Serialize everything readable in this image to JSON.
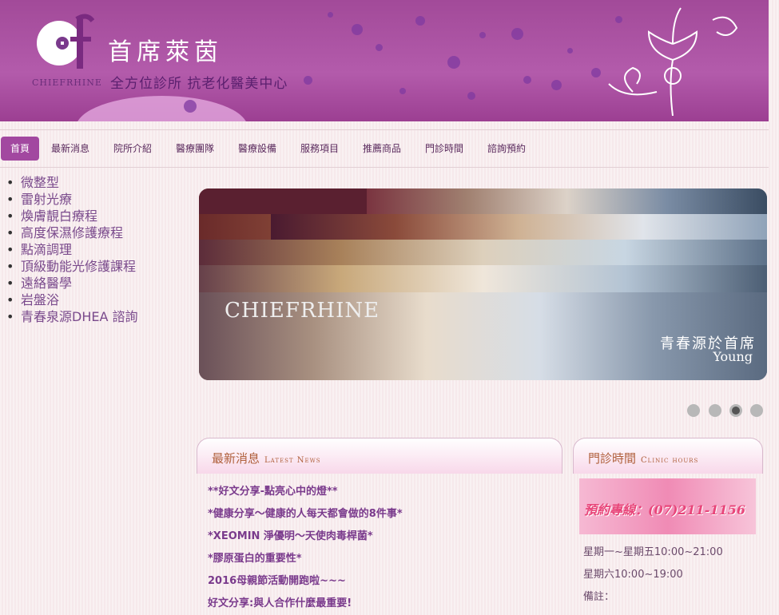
{
  "header": {
    "brand_name": "首席萊茵",
    "brand_en": "CHIEFRHINE",
    "tagline": "全方位診所 抗老化醫美中心"
  },
  "nav": {
    "items": [
      "首頁",
      "最新消息",
      "院所介紹",
      "醫療團隊",
      "醫療設備",
      "服務項目",
      "推薦商品",
      "門診時間",
      "諮詢預約"
    ],
    "active": "首頁"
  },
  "sidebar": {
    "items": [
      "微整型",
      "雷射光療",
      "煥膚靚白療程",
      "高度保濕修護療程",
      "點滴調理",
      "頂級動能光修護課程",
      "遠絡醫學",
      "岩盤浴",
      "青春泉源DHEA 諮詢"
    ]
  },
  "slider": {
    "caption": "青春源於首席",
    "caption_en": "Young",
    "logo_text": "CHIEFRHINE",
    "slide_count": 4,
    "active_slide": 3
  },
  "news": {
    "title": "最新消息",
    "title_en": "Latest News",
    "items": [
      "**好文分享-點亮心中的燈**",
      "*健康分享～健康的人每天都會做的8件事*",
      "*XEOMIN 淨優明～天使肉毒桿菌*",
      "*膠原蛋白的重要性*",
      "2016母親節活動開跑啦~~~",
      "好文分享:與人合作什麼最重要!"
    ]
  },
  "hours": {
    "title": "門診時間",
    "title_en": "Clinic hours",
    "phone": "預約專線：(07)211-1156",
    "lines": [
      "星期一~星期五10:00~21:00",
      "星期六10:00~19:00",
      "備註："
    ]
  },
  "colors": {
    "brand_purple": "#a248a0",
    "banner": "#b35bab",
    "text_purple": "#7a3a8c"
  }
}
